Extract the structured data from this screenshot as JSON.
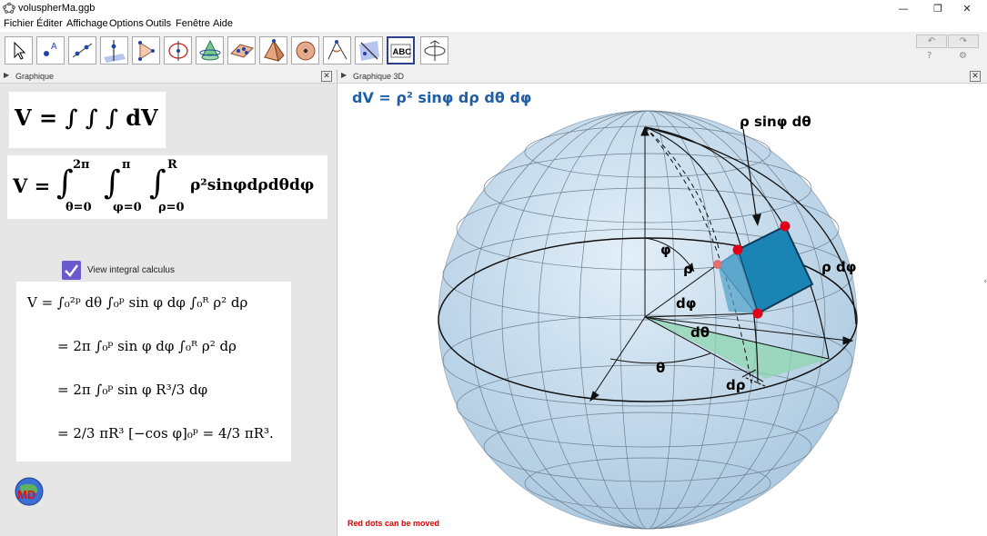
{
  "window": {
    "title": "voluspherMa.ggb",
    "minimize": "—",
    "restore": "❐",
    "close": "✕"
  },
  "menu": [
    "Fichier",
    "Éditer",
    "Affichage",
    "Options",
    "Outils",
    "Fenêtre",
    "Aide"
  ],
  "toolbar": {
    "tools": [
      "move-tool",
      "point-tool",
      "line-tool",
      "perpendicular-line-tool",
      "polygon-tool",
      "circle-tool",
      "intersect-surfaces-tool",
      "plane-tool",
      "pyramid-tool",
      "sphere-tool",
      "angle-tool",
      "reflect-tool",
      "text-tool",
      "rotate-view-tool"
    ],
    "text_tool_label": "ABC",
    "undo": "↶",
    "redo": "↷",
    "help": "?",
    "settings": "⚙"
  },
  "graphics_panel": {
    "title": "Graphique",
    "formula1": "V = ∫ ∫ ∫ dV",
    "formula2": {
      "lhs": "V =",
      "int1_upper": "2π",
      "int1_lower": "θ=0",
      "int2_upper": "π",
      "int2_lower": "φ=0",
      "int3_upper": "R",
      "int3_lower": "ρ=0",
      "integrand": "ρ²sinφdρdθdφ"
    },
    "checkbox_label": "View integral calculus",
    "checkbox_checked": true,
    "calc_lines": [
      "V = ∫₀²ᵖ dθ ∫₀ᵖ sin φ dφ ∫₀ᴿ ρ² dρ",
      "= 2π ∫₀ᵖ sin φ dφ ∫₀ᴿ ρ² dρ",
      "= 2π ∫₀ᵖ sin φ R³/3 dφ",
      "= 2/3 πR³ [−cos φ]₀ᵖ = 4/3 πR³."
    ],
    "logo_text": "MD"
  },
  "graphics3d_panel": {
    "title": "Graphique 3D",
    "heading": "dV = ρ² sinφ dρ dθ dφ",
    "labels": {
      "rho_sinphi_dtheta": "ρ sinφ dθ",
      "rho_dphi": "ρ dφ",
      "phi": "φ",
      "rho": "ρ",
      "dphi": "dφ",
      "dtheta": "dθ",
      "theta": "θ",
      "drho": "dρ"
    },
    "note": "Red dots can be moved"
  },
  "colors": {
    "sphere_fill": "#c9dff0",
    "volume_element": "#1a85b5",
    "sector_green": "#8fd6b0",
    "red_dot": "#e0001a",
    "heading": "#1e5fa8"
  }
}
